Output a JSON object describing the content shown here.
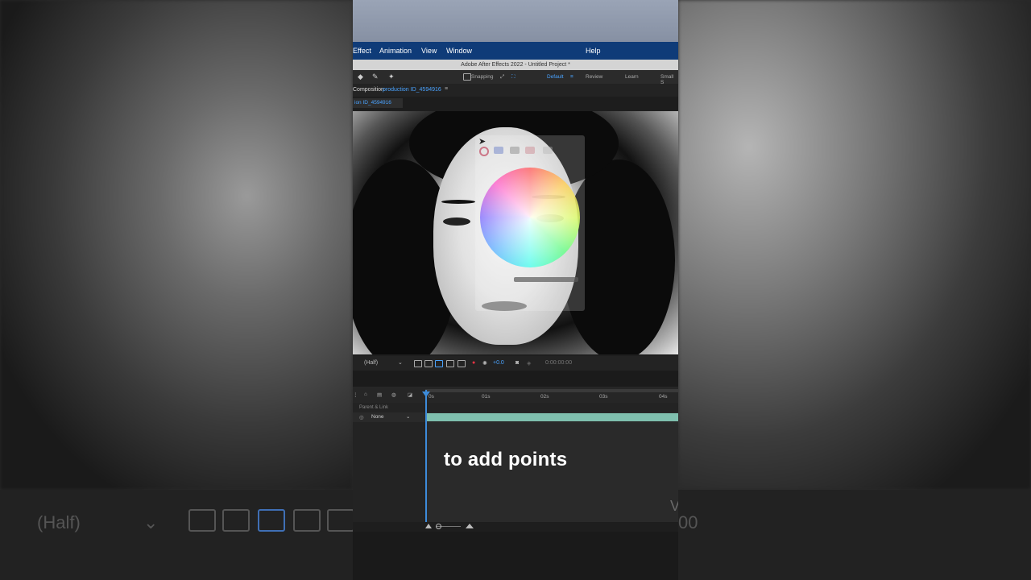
{
  "menu": {
    "effect": "Effect",
    "animation": "Animation",
    "view": "View",
    "window": "Window",
    "help": "Help"
  },
  "title_bar": "Adobe After Effects 2022 - Untitled Project *",
  "toolbar": {
    "snapping": "Snapping",
    "workspace_default": "Default",
    "workspace_review": "Review",
    "workspace_learn": "Learn",
    "workspace_small": "Small S"
  },
  "panel": {
    "composition_label": "Composition",
    "composition_name": "production ID_4594916",
    "tab_name": "ion ID_4594916"
  },
  "viewer_controls": {
    "resolution": "(Half)",
    "exposure": "+0.0",
    "timecode": "0:00:00:00"
  },
  "timeline": {
    "ticks": [
      "0s",
      "01s",
      "02s",
      "03s",
      "04s"
    ],
    "parent_link_header": "Parent & Link",
    "parent_value": "None"
  },
  "caption": "to add points",
  "watermark": "V",
  "backdrop": {
    "resolution": "(Half)",
    "right_number": "00"
  }
}
